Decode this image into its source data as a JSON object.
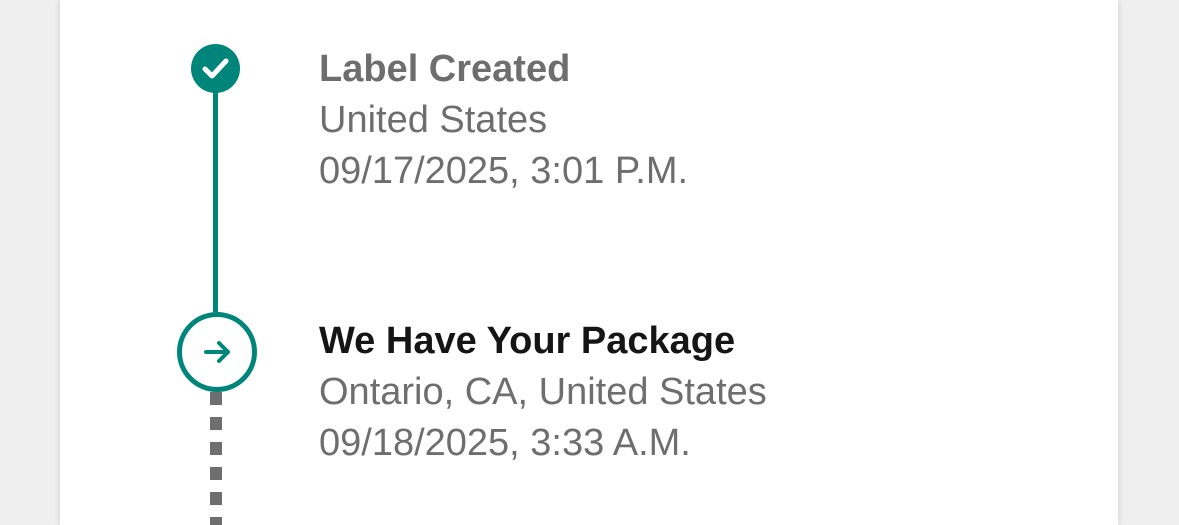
{
  "tracking": {
    "events": [
      {
        "status": "complete",
        "title": "Label Created",
        "location": "United States",
        "timestamp": "09/17/2025, 3:01 P.M.",
        "icon": "check-icon"
      },
      {
        "status": "current",
        "title": "We Have Your Package",
        "location": "Ontario, CA, United States",
        "timestamp": "09/18/2025, 3:33 A.M.",
        "icon": "arrow-right-icon"
      }
    ]
  },
  "colors": {
    "accent": "#00857a",
    "muted_text": "#6e6e6e",
    "primary_text": "#151515",
    "card_background": "#ffffff",
    "page_background": "#efefef"
  }
}
